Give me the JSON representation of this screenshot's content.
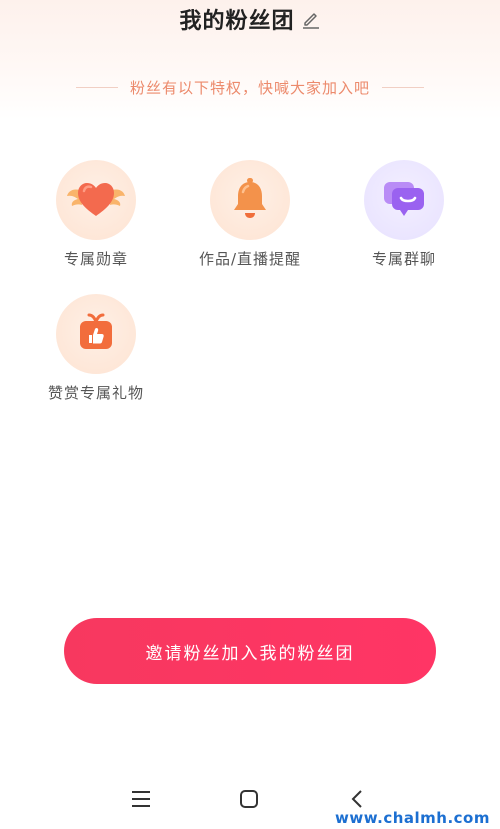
{
  "header": {
    "title": "我的粉丝团",
    "edit_icon": "pencil-edit-icon"
  },
  "subtitle": "粉丝有以下特权，快喊大家加入吧",
  "colors": {
    "accent": "#f7385f",
    "subtitle": "#ec8a6c",
    "heart": "#f36a4e",
    "bell": "#f3924b",
    "chat": "#9a62f0",
    "gift": "#f26d3c"
  },
  "perks": [
    {
      "label": "专属勋章",
      "icon": "winged-heart-icon"
    },
    {
      "label": "作品/直播提醒",
      "icon": "bell-icon"
    },
    {
      "label": "专属群聊",
      "icon": "chat-bubbles-icon"
    },
    {
      "label": "赞赏专属礼物",
      "icon": "gift-box-icon"
    }
  ],
  "invite_button": "邀请粉丝加入我的粉丝团",
  "nav_bar": {
    "menu_icon": "menu-icon",
    "home_icon": "home-square-icon",
    "back_icon": "back-chevron-icon"
  },
  "watermark": "www.chalmh.com"
}
